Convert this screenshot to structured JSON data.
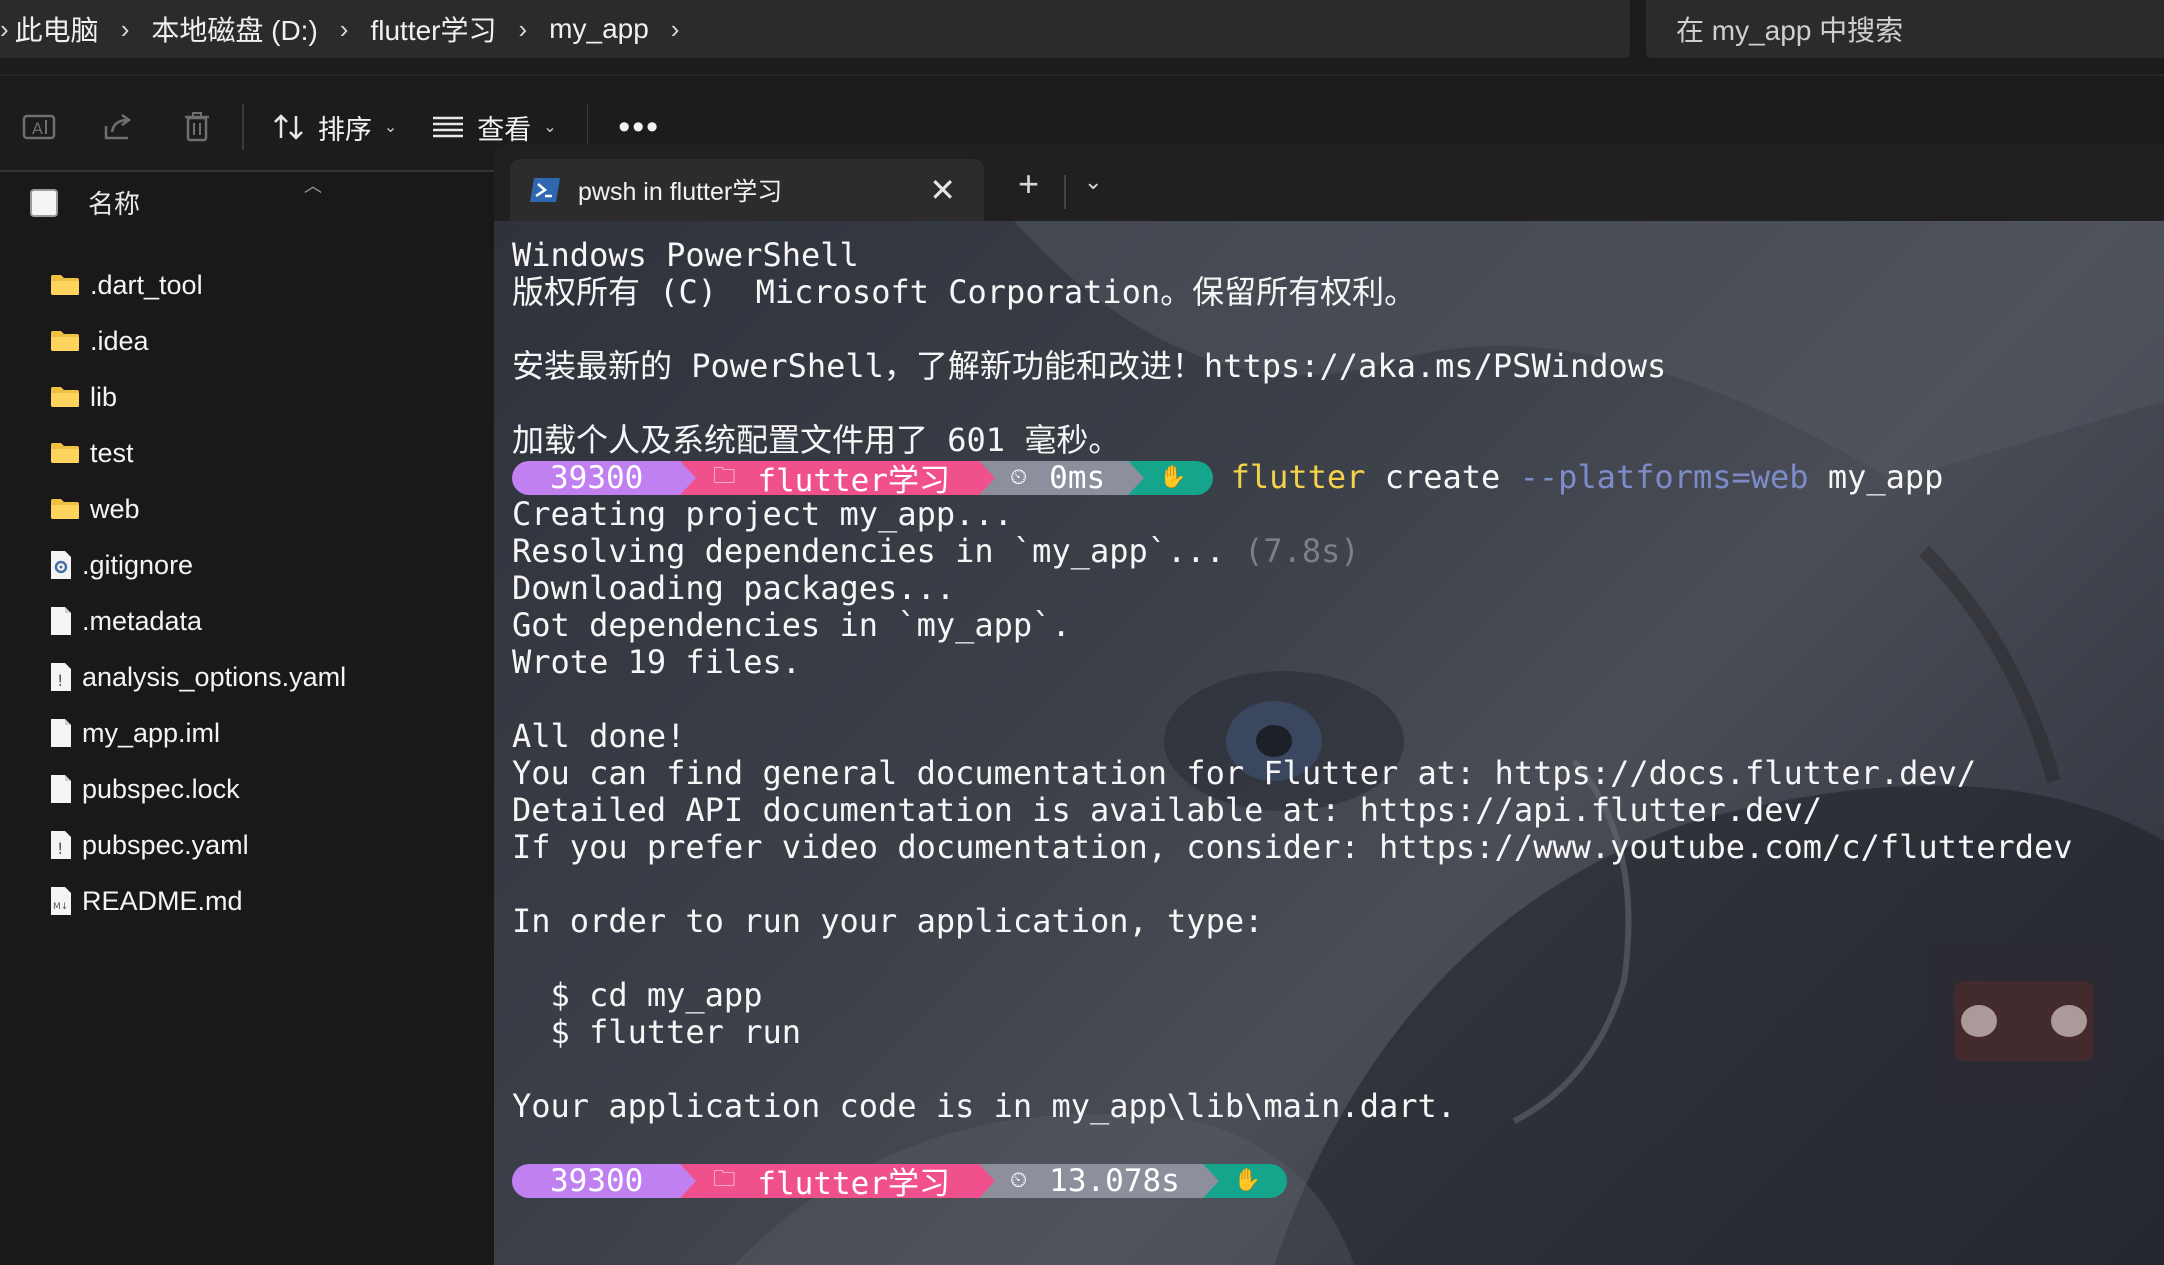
{
  "address": {
    "crumbs": [
      "此电脑",
      "本地磁盘 (D:)",
      "flutter学习",
      "my_app"
    ],
    "search_placeholder": "在 my_app 中搜索"
  },
  "toolbar": {
    "sort_label": "排序",
    "view_label": "查看",
    "more_label": "•••"
  },
  "filelist": {
    "header": "名称",
    "items": [
      {
        "name": ".dart_tool",
        "kind": "folder"
      },
      {
        "name": ".idea",
        "kind": "folder"
      },
      {
        "name": "lib",
        "kind": "folder"
      },
      {
        "name": "test",
        "kind": "folder"
      },
      {
        "name": "web",
        "kind": "folder"
      },
      {
        "name": ".gitignore",
        "kind": "settings-file"
      },
      {
        "name": ".metadata",
        "kind": "file"
      },
      {
        "name": "analysis_options.yaml",
        "kind": "yaml-file"
      },
      {
        "name": "my_app.iml",
        "kind": "file"
      },
      {
        "name": "pubspec.lock",
        "kind": "file"
      },
      {
        "name": "pubspec.yaml",
        "kind": "yaml-file"
      },
      {
        "name": "README.md",
        "kind": "markdown-file"
      }
    ]
  },
  "terminal": {
    "tab_title": "pwsh in flutter学习",
    "lines": {
      "l1": "Windows PowerShell",
      "l2": "版权所有 (C)  Microsoft Corporation。保留所有权利。",
      "l3": "",
      "l4": "安装最新的 PowerShell，了解新功能和改进！https://aka.ms/PSWindows",
      "l5": "",
      "l6": "加载个人及系统配置文件用了 601 毫秒。",
      "l8": "Creating project my_app...",
      "l9a": "Resolving dependencies in `my_app`... ",
      "l9b": "(7.8s)",
      "l10": "Downloading packages...",
      "l11": "Got dependencies in `my_app`.",
      "l12": "Wrote 19 files.",
      "l13": "",
      "l14": "All done!",
      "l15": "You can find general documentation for Flutter at: https://docs.flutter.dev/",
      "l16": "Detailed API documentation is available at: https://api.flutter.dev/",
      "l17": "If you prefer video documentation, consider: https://www.youtube.com/c/flutterdev",
      "l18": "",
      "l19": "In order to run your application, type:",
      "l20": "",
      "l21": "  $ cd my_app",
      "l22": "  $ flutter run",
      "l23": "",
      "l24": "Your application code is in my_app\\lib\\main.dart."
    },
    "prompt1": {
      "seg_a": "39300",
      "seg_b": "flutter学习",
      "seg_c": "0ms",
      "cmd_word": "flutter",
      "cmd_sub": " create ",
      "cmd_flag": "--platforms=web",
      "cmd_arg": " my_app"
    },
    "prompt2": {
      "seg_a": "39300",
      "seg_b": "flutter学习",
      "seg_c": "13.078s"
    }
  },
  "colors": {
    "seg_a": "#c080f0",
    "seg_b": "#f0508c",
    "seg_c": "#8d8f9c",
    "seg_d": "#14a58c",
    "cmd_flutter": "#f5d24b",
    "cmd_flag": "#7d8cc9"
  }
}
